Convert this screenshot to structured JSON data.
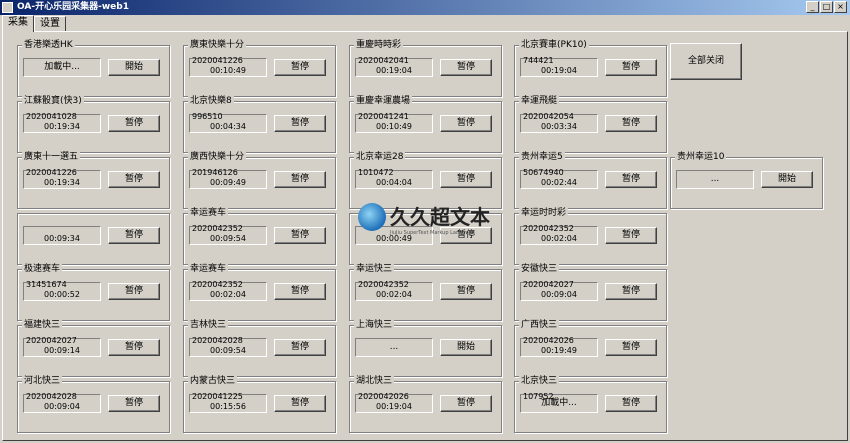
{
  "window": {
    "title": "OA-开心乐园采集器-web1"
  },
  "tabs": [
    {
      "label": "采集",
      "active": true
    },
    {
      "label": "设置",
      "active": false
    }
  ],
  "close_all_label": "全部关闭",
  "watermark": {
    "text": "久久超文本",
    "sub": "JiuJiu SuperText Markup Language"
  },
  "groups": [
    {
      "title": "香港樂透HK",
      "issue": "",
      "timer": "",
      "center": "加載中...",
      "button": "開始"
    },
    {
      "title": "廣東快樂十分",
      "issue": "2020041226",
      "timer": "00:10:49",
      "button": "暂停"
    },
    {
      "title": "重慶時時彩",
      "issue": "2020042041",
      "timer": "00:19:04",
      "button": "暂停"
    },
    {
      "title": "北京賽車(PK10)",
      "issue": "744421",
      "timer": "00:19:04",
      "button": "暂停"
    },
    {
      "title": "江蘇骰寶(快3)",
      "issue": "2020041028",
      "timer": "00:19:34",
      "button": "暂停"
    },
    {
      "title": "北京快樂8",
      "issue": "996510",
      "timer": "00:04:34",
      "button": "暂停"
    },
    {
      "title": "重慶幸運農場",
      "issue": "2020041241",
      "timer": "00:10:49",
      "button": "暂停"
    },
    {
      "title": "幸運飛艇",
      "issue": "2020042054",
      "timer": "00:03:34",
      "button": "暂停"
    },
    {
      "title": "廣東十一選五",
      "issue": "2020041226",
      "timer": "00:19:34",
      "button": "暂停"
    },
    {
      "title": "廣西快樂十分",
      "issue": "201946126",
      "timer": "00:09:49",
      "button": "暂停"
    },
    {
      "title": "北京幸运28",
      "issue": "1010472",
      "timer": "00:04:04",
      "button": "暂停"
    },
    {
      "title": "贵州幸运5",
      "issue": "50674940",
      "timer": "00:02:44",
      "button": "暂停"
    },
    {
      "title": "贵州幸运10",
      "issue": "",
      "timer": "",
      "center": "...",
      "button": "開始"
    },
    {
      "title": "",
      "issue": "",
      "timer": "00:09:34",
      "button": "暂停"
    },
    {
      "title": "幸运赛车",
      "issue": "2020042352",
      "timer": "00:09:54",
      "button": "暂停"
    },
    {
      "title": "",
      "issue": "",
      "timer": "00:00:49",
      "button": "暂停"
    },
    {
      "title": "幸运时时彩",
      "issue": "2020042352",
      "timer": "00:02:04",
      "button": "暂停"
    },
    {
      "title": "极速赛车",
      "issue": "31451674",
      "timer": "00:00:52",
      "button": "暂停"
    },
    {
      "title": "幸运赛车",
      "issue": "2020042352",
      "timer": "00:02:04",
      "button": "暂停"
    },
    {
      "title": "幸运快三",
      "issue": "2020042352",
      "timer": "00:02:04",
      "button": "暂停"
    },
    {
      "title": "安徽快三",
      "issue": "2020042027",
      "timer": "00:09:04",
      "button": "暂停"
    },
    {
      "title": "福建快三",
      "issue": "2020042027",
      "timer": "00:09:14",
      "button": "暂停"
    },
    {
      "title": "吉林快三",
      "issue": "2020042028",
      "timer": "00:09:54",
      "button": "暂停"
    },
    {
      "title": "上海快三",
      "issue": "",
      "timer": "",
      "center": "...",
      "button": "開始"
    },
    {
      "title": "广西快三",
      "issue": "2020042026",
      "timer": "00:19:49",
      "button": "暂停"
    },
    {
      "title": "河北快三",
      "issue": "2020042028",
      "timer": "00:09:04",
      "button": "暂停"
    },
    {
      "title": "内蒙古快三",
      "issue": "2020041225",
      "timer": "00:15:56",
      "button": "暂停"
    },
    {
      "title": "湖北快三",
      "issue": "2020042026",
      "timer": "00:19:04",
      "button": "暂停"
    },
    {
      "title": "北京快三",
      "issue": "107952",
      "timer": "",
      "center": "加載中...",
      "button": "暂停"
    }
  ]
}
